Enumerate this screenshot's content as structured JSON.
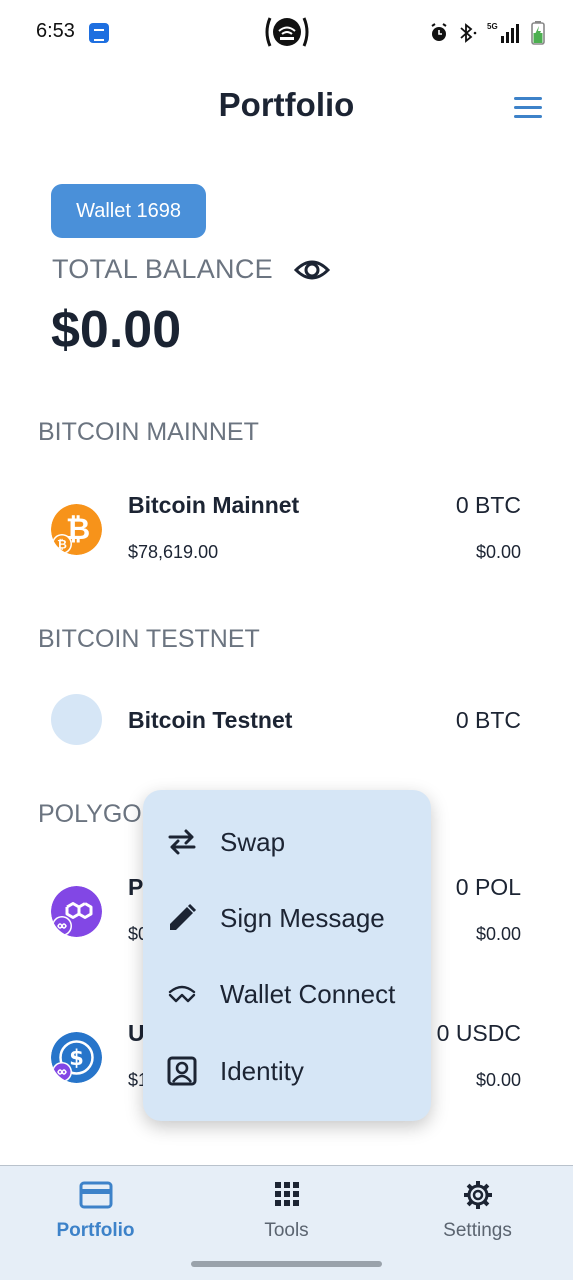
{
  "status_bar": {
    "time": "6:53",
    "network": "5G",
    "icons": [
      "app-notification-icon",
      "cast-icon",
      "alarm-icon",
      "bluetooth-icon",
      "signal-icon",
      "battery-charging-icon"
    ]
  },
  "header": {
    "title": "Portfolio",
    "menu_icon": "hamburger-menu-icon"
  },
  "wallet": {
    "name": "Wallet 1698",
    "balance_label": "TOTAL BALANCE",
    "balance": "$0.00",
    "visibility_icon": "eye-icon"
  },
  "sections": [
    {
      "title": "BITCOIN MAINNET",
      "assets": [
        {
          "name": "Bitcoin Mainnet",
          "price": "$78,619.00",
          "amount": "0 BTC",
          "fiat": "$0.00",
          "icon": "bitcoin-icon"
        }
      ]
    },
    {
      "title": "BITCOIN TESTNET",
      "assets": [
        {
          "name": "Bitcoin Testnet",
          "price": "",
          "amount": "0 BTC",
          "fiat": "",
          "icon": "placeholder-circle-icon"
        }
      ]
    },
    {
      "title": "POLYGON",
      "assets": [
        {
          "name": "P",
          "price": "$0",
          "amount": "0 POL",
          "fiat": "$0.00",
          "icon": "polygon-icon"
        },
        {
          "name": "U",
          "price": "$1",
          "amount": "0 USDC",
          "fiat": "$0.00",
          "icon": "usdc-icon"
        }
      ]
    }
  ],
  "popup_menu": {
    "items": [
      {
        "label": "Swap",
        "icon": "swap-arrows-icon"
      },
      {
        "label": "Sign Message",
        "icon": "pencil-icon"
      },
      {
        "label": "Wallet Connect",
        "icon": "wallet-connect-icon"
      },
      {
        "label": "Identity",
        "icon": "identity-badge-icon"
      }
    ]
  },
  "bottom_nav": {
    "items": [
      {
        "label": "Portfolio",
        "icon": "wallet-card-icon",
        "active": true
      },
      {
        "label": "Tools",
        "icon": "grid-icon",
        "active": false
      },
      {
        "label": "Settings",
        "icon": "gear-icon",
        "active": false
      }
    ]
  },
  "colors": {
    "accent": "#3d82c9",
    "chip": "#4a90d9",
    "popup_bg": "#d6e6f6",
    "nav_bg": "#e6eef7",
    "bitcoin": "#f7931a",
    "polygon": "#8247e5",
    "usdc": "#2775ca",
    "placeholder": "#d6e6f6"
  }
}
